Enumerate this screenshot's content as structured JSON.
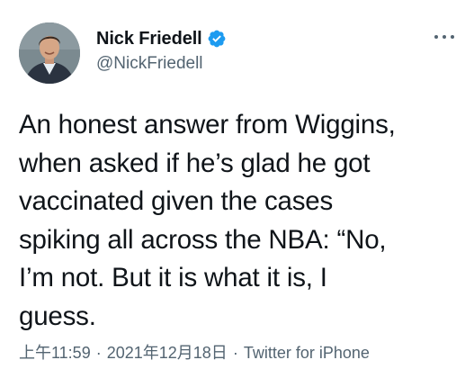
{
  "author": {
    "name": "Nick Friedell",
    "handle": "@NickFriedell",
    "verified_icon": "verified-badge-icon",
    "avatar_icon": "profile-photo",
    "verified_color": "#1d9bf0"
  },
  "menu": {
    "icon": "more-horizontal-icon"
  },
  "tweet": {
    "text": "An honest answer from Wiggins,\nwhen asked if he’s glad he got\nvaccinated given the cases\nspiking all across the NBA: “No,\nI’m not. But it is what it is, I\nguess."
  },
  "meta": {
    "time": "上午11:59",
    "separator": "·",
    "date": "2021年12月18日",
    "source": "Twitter for iPhone"
  }
}
